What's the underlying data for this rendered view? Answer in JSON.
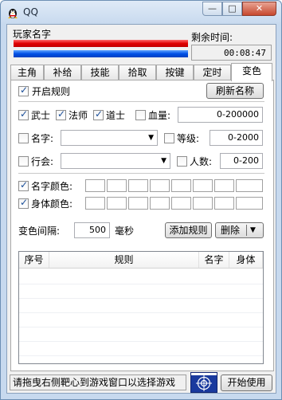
{
  "window": {
    "title": "QQ",
    "controls": {
      "minimize": "—",
      "maximize": "□",
      "close": "✕"
    },
    "colors": {
      "hp_bar": "#e00000",
      "mp_bar": "#0050e6",
      "target_bg": "#1a3a9e"
    }
  },
  "header": {
    "player_name": "玩家名字",
    "remaining_label": "剩余时间:",
    "remaining_time": "00:08:47"
  },
  "tabs": [
    "主角",
    "补给",
    "技能",
    "拾取",
    "按键",
    "定时",
    "变色"
  ],
  "active_tab": "变色",
  "panel": {
    "enable_rule": {
      "label": "开启规则",
      "checked": true
    },
    "refresh_button": "刷新名称",
    "classes": [
      {
        "label": "武士",
        "checked": true
      },
      {
        "label": "法师",
        "checked": true
      },
      {
        "label": "道士",
        "checked": true
      }
    ],
    "hp": {
      "label": "血量:",
      "checked": false,
      "value": "0-200000"
    },
    "name": {
      "label": "名字:",
      "checked": false,
      "value": ""
    },
    "level": {
      "label": "等级:",
      "checked": false,
      "value": "0-2000"
    },
    "guild": {
      "label": "行会:",
      "checked": false,
      "value": ""
    },
    "count": {
      "label": "人数:",
      "checked": false,
      "value": "0-200"
    },
    "name_color": {
      "label": "名字颜色:",
      "checked": true
    },
    "body_color": {
      "label": "身体颜色:",
      "checked": true
    },
    "interval": {
      "label": "变色间隔:",
      "value": "500",
      "unit": "毫秒"
    },
    "add_button": "添加规则",
    "delete_button": "删除"
  },
  "rules_table": {
    "columns": [
      "序号",
      "规则",
      "名字",
      "身体"
    ],
    "rows": []
  },
  "status_bar": {
    "hint": "请拖曳右侧靶心到游戏窗口以选择游戏",
    "start_button": "开始使用"
  }
}
